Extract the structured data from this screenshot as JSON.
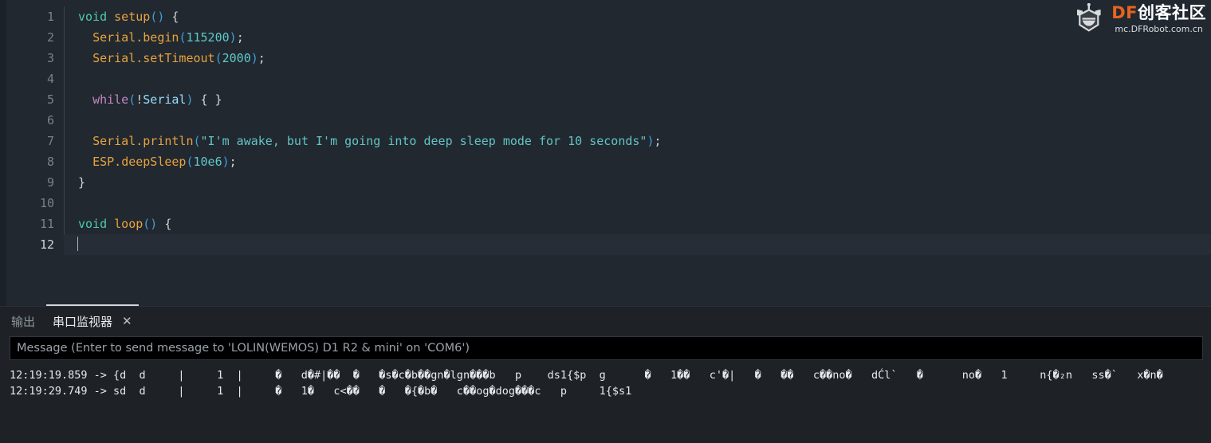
{
  "editor": {
    "line_numbers": [
      "1",
      "2",
      "3",
      "4",
      "5",
      "6",
      "7",
      "8",
      "9",
      "10",
      "11",
      "12"
    ],
    "active_line": "12",
    "lines": [
      {
        "n": "1",
        "text": "void setup() {"
      },
      {
        "n": "2",
        "text": "  Serial.begin(115200);"
      },
      {
        "n": "3",
        "text": "  Serial.setTimeout(2000);"
      },
      {
        "n": "4",
        "text": ""
      },
      {
        "n": "5",
        "text": "  while(!Serial) { }"
      },
      {
        "n": "6",
        "text": ""
      },
      {
        "n": "7",
        "text": "  Serial.println(\"I'm awake, but I'm going into deep sleep mode for 10 seconds\");"
      },
      {
        "n": "8",
        "text": "  ESP.deepSleep(10e6);"
      },
      {
        "n": "9",
        "text": "}"
      },
      {
        "n": "10",
        "text": ""
      },
      {
        "n": "11",
        "text": "void loop() {"
      },
      {
        "n": "12",
        "text": ""
      }
    ],
    "tokens": {
      "l1": {
        "kw": "void",
        "sp": " ",
        "fn": "setup",
        "paren": "()",
        "sp2": " ",
        "brace": "{"
      },
      "l2": {
        "obj": "Serial",
        "dot": ".",
        "fn": "begin",
        "p1": "(",
        "num": "115200",
        "p2": ")",
        "semi": ";"
      },
      "l3": {
        "obj": "Serial",
        "dot": ".",
        "fn": "setTimeout",
        "p1": "(",
        "num": "2000",
        "p2": ")",
        "semi": ";"
      },
      "l5": {
        "ctrl": "while",
        "p1": "(",
        "bang": "!",
        "var": "Serial",
        "p2": ")",
        "rest": " { }"
      },
      "l7": {
        "obj": "Serial",
        "dot": ".",
        "fn": "println",
        "p1": "(",
        "str": "\"I'm awake, but I'm going into deep sleep mode for 10 seconds\"",
        "p2": ")",
        "semi": ";"
      },
      "l8": {
        "obj": "ESP",
        "dot": ".",
        "fn": "deepSleep",
        "p1": "(",
        "num": "10e6",
        "p2": ")",
        "semi": ";"
      },
      "l9": {
        "brace": "}"
      },
      "l11": {
        "kw": "void",
        "sp": " ",
        "fn": "loop",
        "paren": "()",
        "sp2": " ",
        "brace": "{"
      }
    }
  },
  "logo": {
    "icon": "robot-head-icon",
    "brand_df": "DF",
    "brand_cn": "创客社区",
    "url": "mc.DFRobot.com.cn",
    "accent_color": "#e8641e"
  },
  "panel": {
    "tabs": [
      {
        "label": "输出",
        "active": false,
        "closable": false
      },
      {
        "label": "串口监视器",
        "active": true,
        "closable": true,
        "close_glyph": "✕"
      }
    ],
    "message_input": {
      "value": "",
      "placeholder": "Message (Enter to send message to 'LOLIN(WEMOS) D1 R2 & mini' on 'COM6')"
    },
    "console_lines": [
      "12:19:19.859 -> {d  d     |     1  |     �   d�#|��  �   �s�c�b��gn�lgn���b   p    ds1{$p  g      �   1��   c'�|   �   ��   c��no�   dĆl`   �      no�   1     n{�₂n   ss�`   x�n�",
      "12:19:29.749 -> sd  d     |     1  |     �   1�   c<��   �   �{�b�   c��og�dog���c   p     1{$s1"
    ]
  }
}
